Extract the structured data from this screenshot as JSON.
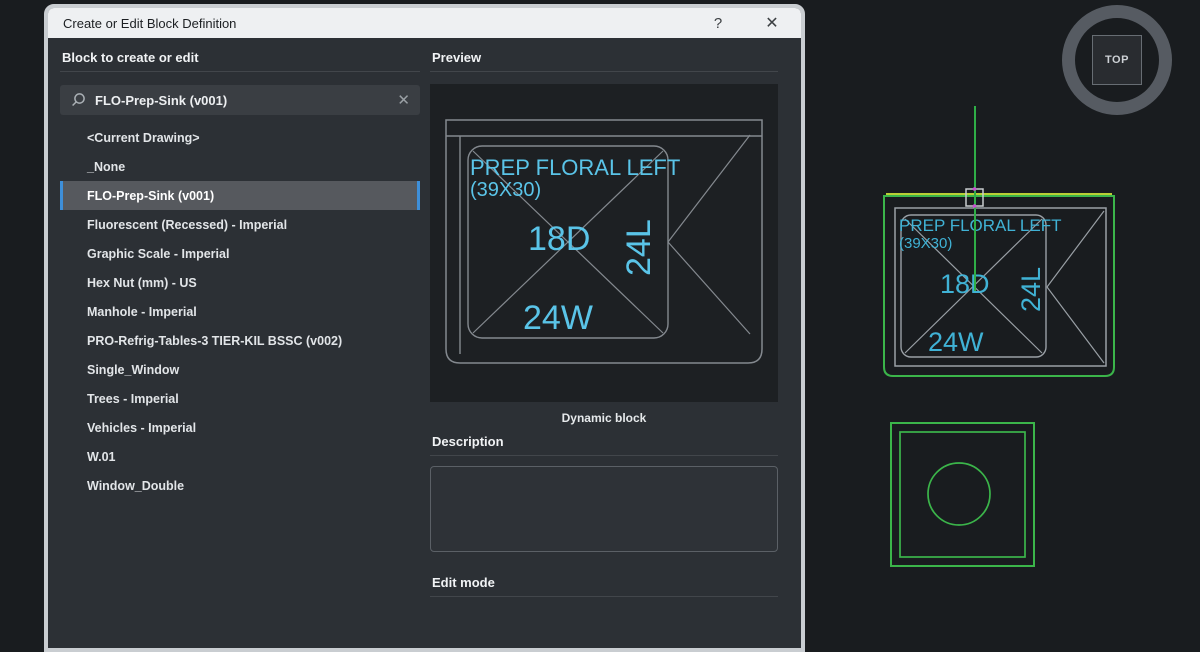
{
  "window": {
    "title": "Create or Edit Block Definition",
    "help_icon": "?",
    "close_icon": "✕"
  },
  "left_panel": {
    "header": "Block to create or edit",
    "search": {
      "value": "FLO-Prep-Sink (v001)",
      "clear_icon": "✕"
    },
    "items": [
      "<Current Drawing>",
      "_None",
      "FLO-Prep-Sink (v001)",
      "Fluorescent (Recessed) - Imperial",
      "Graphic Scale - Imperial",
      "Hex Nut (mm) - US",
      "Manhole - Imperial",
      "PRO-Refrig-Tables-3 TIER-KIL BSSC (v002)",
      "Single_Window",
      "Trees - Imperial",
      "Vehicles - Imperial",
      "W.01",
      "Window_Double"
    ],
    "selected_item": "FLO-Prep-Sink (v001)"
  },
  "right_panel": {
    "preview_header": "Preview",
    "preview_caption": "Dynamic block",
    "description_header": "Description",
    "description_value": "",
    "edit_mode_header": "Edit mode"
  },
  "preview_drawing": {
    "title_line1": "PREP FLORAL LEFT",
    "title_line2": "(39X30)",
    "depth_label": "18D",
    "length_label": "24L",
    "width_label": "24W"
  },
  "canvas": {
    "viewcube_label": "TOP",
    "block_labels": {
      "title_line1": "PREP FLORAL LEFT",
      "title_line2": "(39X30)",
      "depth_label": "18D",
      "length_label": "24L",
      "width_label": "24W"
    },
    "colors": {
      "cad_green": "#3BB54A",
      "cad_cyan": "#45B6D9",
      "highlight_yellow": "#B9CF35",
      "selection_blue": "#3E8FD9",
      "osnap_magenta": "#CC4FD4"
    }
  }
}
